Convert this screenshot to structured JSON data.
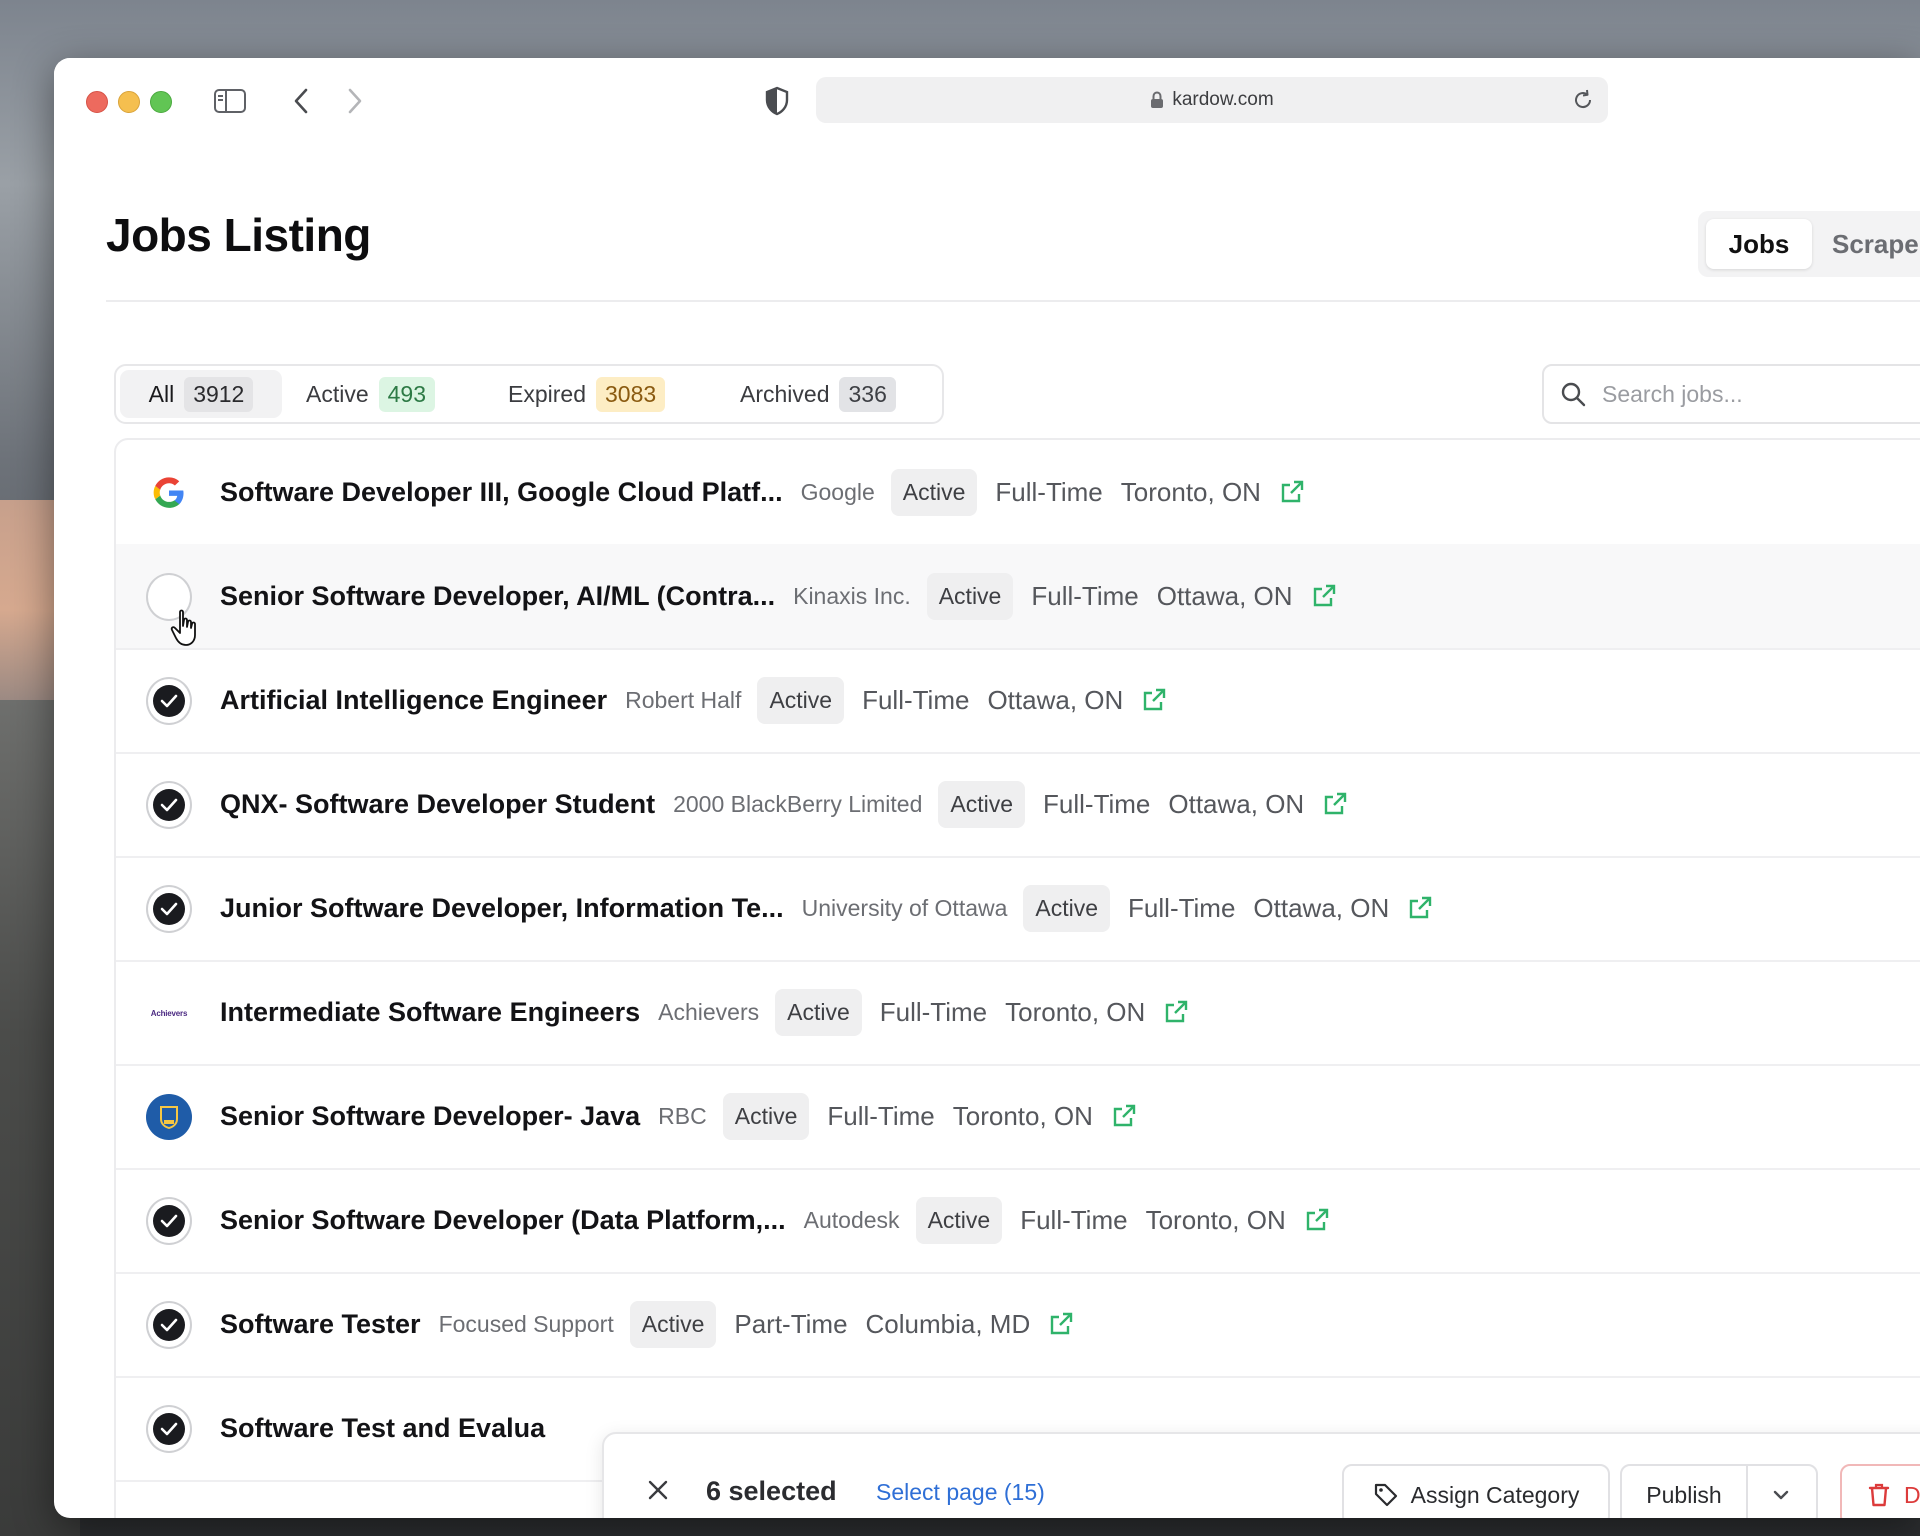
{
  "browser": {
    "url": "kardow.com"
  },
  "page": {
    "title": "Jobs Listing",
    "view_tabs": [
      "Jobs",
      "Scrape"
    ]
  },
  "filters": [
    {
      "label": "All",
      "count": "3912"
    },
    {
      "label": "Active",
      "count": "493"
    },
    {
      "label": "Expired",
      "count": "3083"
    },
    {
      "label": "Archived",
      "count": "336"
    }
  ],
  "search": {
    "placeholder": "Search jobs..."
  },
  "jobs": [
    {
      "title": "Software Developer III, Google Cloud Platf...",
      "company": "Google",
      "status": "Active",
      "type": "Full-Time",
      "location": "Toronto, ON",
      "lead": "google-logo"
    },
    {
      "title": "Senior Software Developer, AI/ML (Contra...",
      "company": "Kinaxis Inc.",
      "status": "Active",
      "type": "Full-Time",
      "location": "Ottawa, ON",
      "lead": "checkbox-unchecked"
    },
    {
      "title": "Artificial Intelligence Engineer",
      "company": "Robert Half",
      "status": "Active",
      "type": "Full-Time",
      "location": "Ottawa, ON",
      "lead": "checkbox-checked"
    },
    {
      "title": "QNX- Software Developer Student",
      "company": "2000 BlackBerry Limited",
      "status": "Active",
      "type": "Full-Time",
      "location": "Ottawa, ON",
      "lead": "checkbox-checked"
    },
    {
      "title": "Junior Software Developer, Information Te...",
      "company": "University of Ottawa",
      "status": "Active",
      "type": "Full-Time",
      "location": "Ottawa, ON",
      "lead": "checkbox-checked"
    },
    {
      "title": "Intermediate Software Engineers",
      "company": "Achievers",
      "status": "Active",
      "type": "Full-Time",
      "location": "Toronto, ON",
      "lead": "achievers-logo",
      "logo_text": "Achievers"
    },
    {
      "title": "Senior Software Developer- Java",
      "company": "RBC",
      "status": "Active",
      "type": "Full-Time",
      "location": "Toronto, ON",
      "lead": "rbc-logo"
    },
    {
      "title": "Senior Software Developer (Data Platform,...",
      "company": "Autodesk",
      "status": "Active",
      "type": "Full-Time",
      "location": "Toronto, ON",
      "lead": "checkbox-checked"
    },
    {
      "title": "Software Tester",
      "company": "Focused Support",
      "status": "Active",
      "type": "Part-Time",
      "location": "Columbia, MD",
      "lead": "checkbox-checked"
    },
    {
      "title": "Software Test and Evalua",
      "company": "",
      "status": "",
      "type": "",
      "location": "",
      "lead": "checkbox-checked"
    }
  ],
  "bulk_bar": {
    "count_label": "6 selected",
    "select_page_label": "Select page (15)",
    "assign_label": "Assign Category",
    "publish_label": "Publish",
    "delete_label": "Delete"
  },
  "colors": {
    "accent_link": "#2f6fd6",
    "external_link_icon": "#2fb36a",
    "delete": "#dc3b3b"
  }
}
